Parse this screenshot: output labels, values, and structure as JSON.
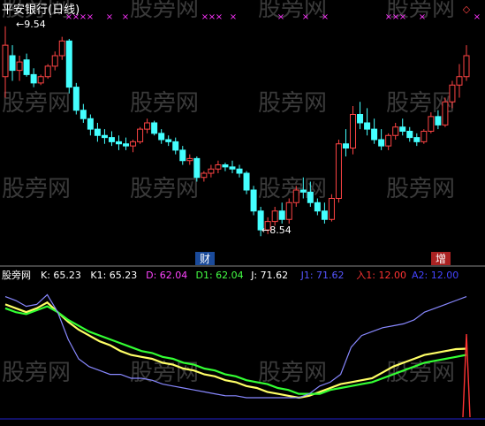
{
  "watermark": "股旁网",
  "upper": {
    "title": "平安银行(日线)",
    "high_label": "9.54",
    "low_label": "8.54",
    "event_markers": [
      "财",
      "增"
    ]
  },
  "indicator": {
    "name": "股旁网",
    "values": [
      {
        "label": "K: 65.23",
        "color": "#ffffff"
      },
      {
        "label": "K1: 65.23",
        "color": "#ffffff"
      },
      {
        "label": "D: 62.04",
        "color": "#ff44ff"
      },
      {
        "label": "D1: 62.04",
        "color": "#44ff44"
      },
      {
        "label": "J: 71.62",
        "color": "#ffffff"
      },
      {
        "label": "J1: 71.62",
        "color": "#5555ff"
      },
      {
        "label": "入1: 12.00",
        "color": "#ff3333"
      },
      {
        "label": "A2: 12.00",
        "color": "#4444ff"
      }
    ]
  },
  "chart_data": [
    {
      "type": "candlestick",
      "title": "平安银行(日线)",
      "annotations": [
        "9.54",
        "8.54",
        "财",
        "增"
      ],
      "low": 8.54,
      "high": 9.54,
      "candles": [
        {
          "o": 9.3,
          "h": 9.54,
          "l": 9.2,
          "c": 9.45
        },
        {
          "o": 9.4,
          "h": 9.45,
          "l": 9.28,
          "c": 9.33
        },
        {
          "o": 9.33,
          "h": 9.4,
          "l": 9.28,
          "c": 9.37
        },
        {
          "o": 9.38,
          "h": 9.41,
          "l": 9.3,
          "c": 9.31
        },
        {
          "o": 9.31,
          "h": 9.34,
          "l": 9.25,
          "c": 9.27
        },
        {
          "o": 9.27,
          "h": 9.31,
          "l": 9.26,
          "c": 9.3
        },
        {
          "o": 9.3,
          "h": 9.36,
          "l": 9.29,
          "c": 9.35
        },
        {
          "o": 9.35,
          "h": 9.42,
          "l": 9.33,
          "c": 9.4
        },
        {
          "o": 9.4,
          "h": 9.49,
          "l": 9.38,
          "c": 9.47
        },
        {
          "o": 9.47,
          "h": 9.48,
          "l": 9.22,
          "c": 9.25
        },
        {
          "o": 9.25,
          "h": 9.27,
          "l": 9.12,
          "c": 9.14
        },
        {
          "o": 9.14,
          "h": 9.17,
          "l": 9.08,
          "c": 9.1
        },
        {
          "o": 9.1,
          "h": 9.12,
          "l": 9.02,
          "c": 9.05
        },
        {
          "o": 9.05,
          "h": 9.08,
          "l": 8.99,
          "c": 9.02
        },
        {
          "o": 9.02,
          "h": 9.05,
          "l": 8.98,
          "c": 9.01
        },
        {
          "o": 9.01,
          "h": 9.04,
          "l": 8.97,
          "c": 8.99
        },
        {
          "o": 8.99,
          "h": 9.02,
          "l": 8.95,
          "c": 8.98
        },
        {
          "o": 8.98,
          "h": 9.01,
          "l": 8.95,
          "c": 8.97
        },
        {
          "o": 8.97,
          "h": 9.0,
          "l": 8.94,
          "c": 8.99
        },
        {
          "o": 8.99,
          "h": 9.06,
          "l": 8.98,
          "c": 9.05
        },
        {
          "o": 9.05,
          "h": 9.1,
          "l": 9.03,
          "c": 9.08
        },
        {
          "o": 9.08,
          "h": 9.09,
          "l": 9.02,
          "c": 9.03
        },
        {
          "o": 9.03,
          "h": 9.05,
          "l": 8.98,
          "c": 9.0
        },
        {
          "o": 9.0,
          "h": 9.02,
          "l": 8.97,
          "c": 8.99
        },
        {
          "o": 8.99,
          "h": 9.01,
          "l": 8.93,
          "c": 8.95
        },
        {
          "o": 8.95,
          "h": 8.97,
          "l": 8.88,
          "c": 8.9
        },
        {
          "o": 8.9,
          "h": 8.93,
          "l": 8.88,
          "c": 8.91
        },
        {
          "o": 8.91,
          "h": 8.92,
          "l": 8.8,
          "c": 8.82
        },
        {
          "o": 8.82,
          "h": 8.85,
          "l": 8.8,
          "c": 8.84
        },
        {
          "o": 8.84,
          "h": 8.88,
          "l": 8.82,
          "c": 8.86
        },
        {
          "o": 8.86,
          "h": 8.9,
          "l": 8.84,
          "c": 8.88
        },
        {
          "o": 8.88,
          "h": 8.89,
          "l": 8.85,
          "c": 8.87
        },
        {
          "o": 8.87,
          "h": 8.9,
          "l": 8.84,
          "c": 8.86
        },
        {
          "o": 8.86,
          "h": 8.88,
          "l": 8.82,
          "c": 8.84
        },
        {
          "o": 8.84,
          "h": 8.85,
          "l": 8.74,
          "c": 8.76
        },
        {
          "o": 8.76,
          "h": 8.78,
          "l": 8.64,
          "c": 8.66
        },
        {
          "o": 8.66,
          "h": 8.68,
          "l": 8.54,
          "c": 8.57
        },
        {
          "o": 8.57,
          "h": 8.63,
          "l": 8.55,
          "c": 8.61
        },
        {
          "o": 8.61,
          "h": 8.68,
          "l": 8.59,
          "c": 8.66
        },
        {
          "o": 8.66,
          "h": 8.7,
          "l": 8.6,
          "c": 8.62
        },
        {
          "o": 8.62,
          "h": 8.72,
          "l": 8.6,
          "c": 8.7
        },
        {
          "o": 8.7,
          "h": 8.78,
          "l": 8.68,
          "c": 8.76
        },
        {
          "o": 8.76,
          "h": 8.82,
          "l": 8.72,
          "c": 8.75
        },
        {
          "o": 8.75,
          "h": 8.8,
          "l": 8.68,
          "c": 8.7
        },
        {
          "o": 8.7,
          "h": 8.72,
          "l": 8.64,
          "c": 8.66
        },
        {
          "o": 8.66,
          "h": 8.7,
          "l": 8.6,
          "c": 8.62
        },
        {
          "o": 8.62,
          "h": 8.74,
          "l": 8.61,
          "c": 8.72
        },
        {
          "o": 8.72,
          "h": 9.0,
          "l": 8.7,
          "c": 8.98
        },
        {
          "o": 8.98,
          "h": 9.05,
          "l": 8.92,
          "c": 8.96
        },
        {
          "o": 8.96,
          "h": 9.16,
          "l": 8.93,
          "c": 9.12
        },
        {
          "o": 9.12,
          "h": 9.18,
          "l": 9.05,
          "c": 9.08
        },
        {
          "o": 9.08,
          "h": 9.15,
          "l": 9.02,
          "c": 9.05
        },
        {
          "o": 9.05,
          "h": 9.1,
          "l": 8.98,
          "c": 9.0
        },
        {
          "o": 9.0,
          "h": 9.05,
          "l": 8.95,
          "c": 8.97
        },
        {
          "o": 8.97,
          "h": 9.03,
          "l": 8.95,
          "c": 9.02
        },
        {
          "o": 9.02,
          "h": 9.08,
          "l": 9.0,
          "c": 9.06
        },
        {
          "o": 9.06,
          "h": 9.1,
          "l": 9.02,
          "c": 9.04
        },
        {
          "o": 9.04,
          "h": 9.06,
          "l": 8.99,
          "c": 9.01
        },
        {
          "o": 9.01,
          "h": 9.03,
          "l": 8.97,
          "c": 8.99
        },
        {
          "o": 8.99,
          "h": 9.05,
          "l": 8.98,
          "c": 9.04
        },
        {
          "o": 9.04,
          "h": 9.13,
          "l": 9.03,
          "c": 9.11
        },
        {
          "o": 9.11,
          "h": 9.14,
          "l": 9.05,
          "c": 9.07
        },
        {
          "o": 9.07,
          "h": 9.2,
          "l": 9.06,
          "c": 9.18
        },
        {
          "o": 9.18,
          "h": 9.28,
          "l": 9.15,
          "c": 9.26
        },
        {
          "o": 9.26,
          "h": 9.36,
          "l": 9.2,
          "c": 9.3
        },
        {
          "o": 9.3,
          "h": 9.45,
          "l": 9.28,
          "c": 9.4
        }
      ]
    },
    {
      "type": "line",
      "title": "股旁网",
      "series": [
        {
          "name": "K",
          "color": "#ffff66",
          "values": [
            88,
            86,
            84,
            86,
            89,
            84,
            79,
            75,
            72,
            69,
            67,
            64,
            62,
            61,
            60,
            58,
            57,
            55,
            54,
            52,
            51,
            49,
            48,
            46,
            45,
            43,
            42,
            41,
            40,
            41,
            43,
            45,
            47,
            48,
            49,
            50,
            53,
            56,
            58,
            60,
            62,
            63,
            64,
            65,
            65.23
          ]
        },
        {
          "name": "D",
          "color": "#33ff33",
          "values": [
            86,
            84,
            83,
            85,
            87,
            84,
            80,
            77,
            74,
            72,
            70,
            68,
            66,
            64,
            63,
            61,
            60,
            58,
            57,
            55,
            54,
            52,
            51,
            49,
            48,
            47,
            45,
            44,
            42,
            42,
            42,
            44,
            45,
            46,
            47,
            48,
            50,
            52,
            54,
            56,
            58,
            59,
            60,
            61,
            62.04
          ]
        },
        {
          "name": "J",
          "color": "#8888ff",
          "values": [
            92,
            90,
            87,
            88,
            93,
            84,
            70,
            60,
            56,
            54,
            52,
            52,
            50,
            50,
            49,
            47,
            46,
            45,
            44,
            43,
            42,
            41,
            41,
            40,
            40,
            40,
            40,
            40,
            40,
            42,
            46,
            48,
            52,
            66,
            72,
            74,
            76,
            77,
            78,
            80,
            84,
            86,
            88,
            90,
            92
          ]
        },
        {
          "name": "入1",
          "color": "#ff3333",
          "values": [
            null,
            null,
            null,
            null,
            null,
            null,
            null,
            null,
            null,
            null,
            null,
            null,
            null,
            null,
            null,
            null,
            null,
            null,
            null,
            null,
            null,
            null,
            null,
            null,
            null,
            null,
            null,
            null,
            12
          ]
        }
      ]
    }
  ]
}
